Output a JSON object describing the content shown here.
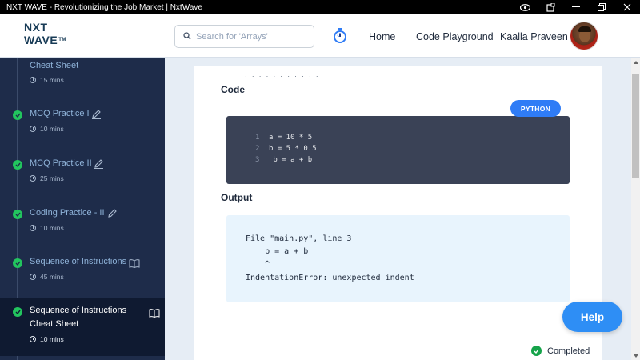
{
  "window": {
    "title": "NXT WAVE - Revolutionizing the Job Market | NxtWave",
    "icons": [
      "eye-icon",
      "extension-icon",
      "minimize-icon",
      "restore-icon",
      "close-icon"
    ]
  },
  "header": {
    "logo_line1": "NXT",
    "logo_line2": "WAVE",
    "logo_tm": "TM",
    "search_placeholder": "Search for 'Arrays'",
    "nav": {
      "home": "Home",
      "code_playground": "Code Playground"
    },
    "user_name": "Kaalla Praveen"
  },
  "sidebar": {
    "items": [
      {
        "title": "Cheat Sheet",
        "time": "15 mins",
        "icon": "none",
        "completed": false
      },
      {
        "title": "MCQ Practice I",
        "time": "10 mins",
        "icon": "edit-icon",
        "completed": true
      },
      {
        "title": "MCQ Practice II",
        "time": "25 mins",
        "icon": "edit-icon",
        "completed": true
      },
      {
        "title": "Coding Practice - II",
        "time": "10 mins",
        "icon": "edit-icon",
        "completed": true
      },
      {
        "title": "Sequence of Instructions",
        "time": "45 mins",
        "icon": "book-icon",
        "completed": true
      },
      {
        "title_line1": "Sequence of Instructions |",
        "title_line2": "Cheat Sheet",
        "time": "10 mins",
        "icon": "book-icon",
        "completed": true,
        "active": true
      }
    ]
  },
  "main": {
    "cut_text": "· · · · · · · · · · ·",
    "code_label": "Code",
    "language": "PYTHON",
    "code_lines": [
      {
        "n": "1",
        "text": "a = 10 * 5"
      },
      {
        "n": "2",
        "text": "b = 5 * 0.5"
      },
      {
        "n": "3",
        "text": " b = a + b"
      }
    ],
    "output_label": "Output",
    "output_lines": [
      "File \"main.py\", line 3",
      "    b = a + b",
      "    ^",
      "IndentationError: unexpected indent"
    ],
    "status": "Completed"
  },
  "help_label": "Help",
  "colors": {
    "sidebar_bg": "#1e2c4a",
    "accent_blue": "#2f7cf6",
    "success_green": "#22c55e",
    "code_bg": "#3a4256",
    "output_bg": "#e8f4fd"
  }
}
